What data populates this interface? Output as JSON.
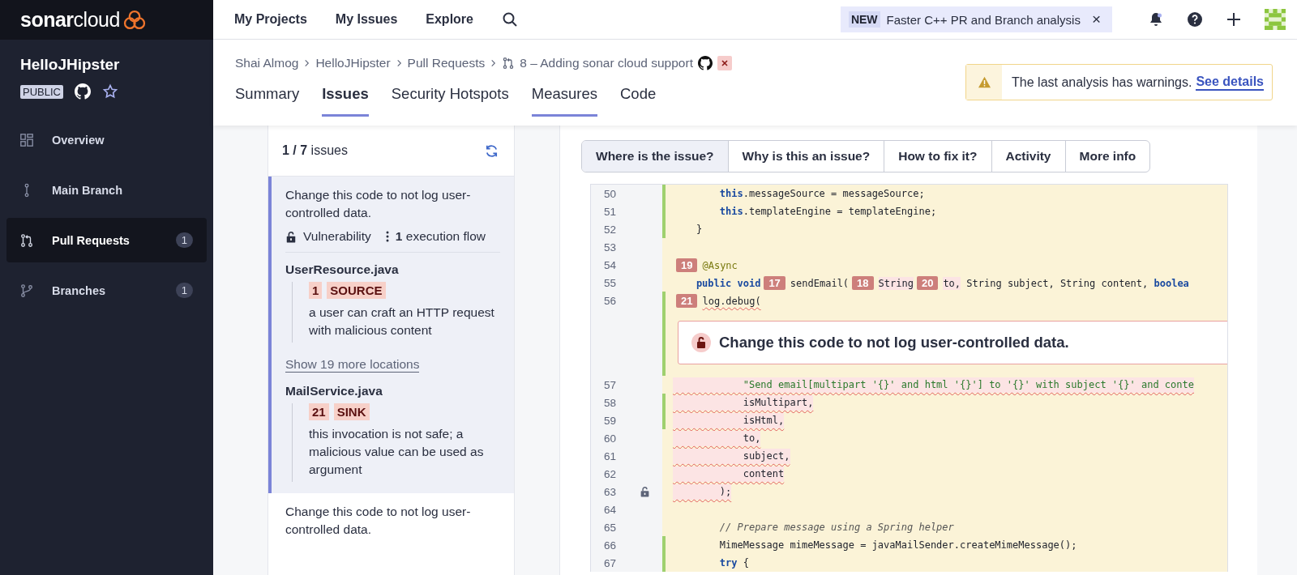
{
  "sidebar": {
    "logo": "**sonar**cloud",
    "project": {
      "name": "HelloJHipster",
      "visibility": "PUBLIC"
    },
    "items": [
      {
        "label": "Overview",
        "selected": false
      },
      {
        "label": "Main Branch",
        "selected": false
      },
      {
        "label": "Pull Requests",
        "selected": true,
        "count": "1"
      },
      {
        "label": "Branches",
        "selected": false,
        "count": "1"
      }
    ]
  },
  "topbar": {
    "nav": [
      "My Projects",
      "My Issues",
      "Explore"
    ],
    "notice": {
      "badge": "NEW",
      "text": "Faster C++ PR and Branch analysis",
      "close": "×"
    }
  },
  "header": {
    "breadcrumb": [
      "Shai Almog",
      "HelloJHipster",
      "Pull Requests"
    ],
    "pull_request": "8 – Adding sonar cloud support",
    "tabs": [
      {
        "label": "Summary",
        "selected": false,
        "hover": false
      },
      {
        "label": "Issues",
        "selected": true,
        "hover": false
      },
      {
        "label": "Security Hotspots",
        "selected": false,
        "hover": false
      },
      {
        "label": "Measures",
        "selected": false,
        "hover": true
      },
      {
        "label": "Code",
        "selected": false,
        "hover": false
      }
    ],
    "warning": {
      "text": "The last analysis has warnings.",
      "link": "See details"
    }
  },
  "issues": {
    "count": "**1 / 7** issues",
    "items": [
      {
        "message": "Change this code to not log user-controlled data.",
        "selected": true,
        "type": "Vulnerability",
        "flow": "**1** execution flow",
        "locations": [
          {
            "kind": "file",
            "file": "UserResource.java",
            "steps": [
              {
                "number": "1",
                "label": "SOURCE",
                "text": "a user can craft an HTTP request with malicious content"
              }
            ]
          },
          {
            "kind": "more",
            "text": "Show 19 more locations"
          },
          {
            "kind": "file",
            "file": "MailService.java",
            "steps": [
              {
                "number": "21",
                "label": "SINK",
                "text": "this invocation is not safe; a malicious value can be used as argument"
              }
            ]
          }
        ]
      },
      {
        "message": "Change this code to not log user-controlled data.",
        "selected": false
      }
    ]
  },
  "code": {
    "tabs": [
      {
        "label": "Where is the issue?",
        "selected": true
      },
      {
        "label": "Why is this an issue?",
        "selected": false
      },
      {
        "label": "How to fix it?",
        "selected": false
      },
      {
        "label": "Activity",
        "selected": false
      },
      {
        "label": "More info",
        "selected": false
      }
    ],
    "lines": [
      {
        "number": "50",
        "changed": true,
        "tokens": [
          {
            "kind": "kw",
            "text": "        this"
          },
          {
            "kind": "plain",
            "text": ".messageSource = messageSource;"
          }
        ]
      },
      {
        "number": "51",
        "changed": true,
        "tokens": [
          {
            "kind": "kw",
            "text": "        this"
          },
          {
            "kind": "plain",
            "text": ".templateEngine = templateEngine;"
          }
        ]
      },
      {
        "number": "52",
        "changed": true,
        "tokens": [
          {
            "kind": "plain",
            "text": "    }"
          }
        ]
      },
      {
        "number": "53",
        "changed": false
      },
      {
        "number": "54",
        "changed": false,
        "tokens": [
          {
            "kind": "marker",
            "text": "19"
          },
          {
            "kind": "ann",
            "text": "@Async"
          }
        ]
      },
      {
        "number": "55",
        "changed": false,
        "tokens": [
          {
            "kind": "kw",
            "text": "    public void"
          },
          {
            "kind": "marker",
            "text": "17"
          },
          {
            "kind": "plain",
            "text": "sendEmail("
          },
          {
            "kind": "marker",
            "text": "18"
          },
          {
            "kind": "hl",
            "text": "String"
          },
          {
            "kind": "marker",
            "text": "20"
          },
          {
            "kind": "hl",
            "text": "to,"
          },
          {
            "kind": "plain",
            "text": " String subject, String content,"
          },
          {
            "kind": "kw",
            "text": " boolea"
          }
        ]
      },
      {
        "number": "56",
        "changed": true,
        "tokens": [
          {
            "kind": "marker",
            "text": "21"
          },
          {
            "kind": "flagged",
            "text": "log.debug("
          }
        ],
        "message": "Change this code to not log user-controlled data."
      },
      {
        "number": "57",
        "changed": false,
        "issue": true,
        "tokens": [
          {
            "kind": "str",
            "text": "            \"Send email[multipart '{}' and html '{}'] to '{}' with subject '{}' and conte"
          }
        ]
      },
      {
        "number": "58",
        "changed": true,
        "issue": true,
        "tokens": [
          {
            "kind": "plain",
            "text": "            isMultipart,"
          }
        ]
      },
      {
        "number": "59",
        "changed": true,
        "issue": true,
        "tokens": [
          {
            "kind": "plain",
            "text": "            isHtml,"
          }
        ]
      },
      {
        "number": "60",
        "changed": false,
        "issue": true,
        "tokens": [
          {
            "kind": "plain",
            "text": "            to,"
          }
        ]
      },
      {
        "number": "61",
        "changed": false,
        "issue": true,
        "tokens": [
          {
            "kind": "plain",
            "text": "            subject,"
          }
        ]
      },
      {
        "number": "62",
        "changed": false,
        "issue": true,
        "tokens": [
          {
            "kind": "plain",
            "text": "            content"
          }
        ]
      },
      {
        "number": "63",
        "changed": false,
        "issue": true,
        "lock": true,
        "tokens": [
          {
            "kind": "plain",
            "text": "        );"
          }
        ]
      },
      {
        "number": "64",
        "changed": false
      },
      {
        "number": "65",
        "changed": false,
        "tokens": [
          {
            "kind": "comment",
            "text": "        // Prepare message using a Spring helper"
          }
        ]
      },
      {
        "number": "66",
        "changed": true,
        "tokens": [
          {
            "kind": "plain",
            "text": "        MimeMessage mimeMessage = javaMailSender.createMimeMessage();"
          }
        ]
      },
      {
        "number": "67",
        "changed": true,
        "tokens": [
          {
            "kind": "kw",
            "text": "        try"
          },
          {
            "kind": "plain",
            "text": " {"
          }
        ]
      }
    ]
  }
}
